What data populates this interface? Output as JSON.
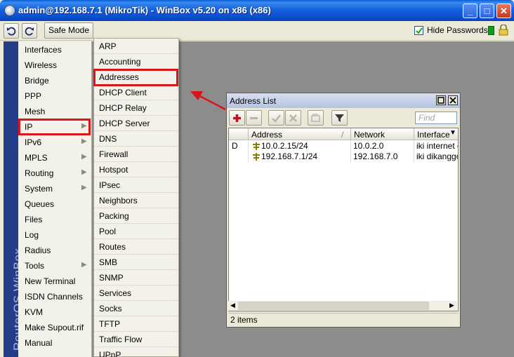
{
  "window": {
    "title": "admin@192.168.7.1 (MikroTik) - WinBox v5.20 on x86 (x86)",
    "minimize": "_",
    "maximize": "□",
    "close": "✕"
  },
  "toolbar": {
    "safe_mode": "Safe Mode",
    "hide_passwords_label": "Hide Passwords",
    "hide_passwords_checked": true
  },
  "brand": "RouterOS WinBox",
  "main_menu": [
    {
      "label": "Interfaces",
      "arrow": false
    },
    {
      "label": "Wireless",
      "arrow": false
    },
    {
      "label": "Bridge",
      "arrow": false
    },
    {
      "label": "PPP",
      "arrow": false
    },
    {
      "label": "Mesh",
      "arrow": false
    },
    {
      "label": "IP",
      "arrow": true
    },
    {
      "label": "IPv6",
      "arrow": true
    },
    {
      "label": "MPLS",
      "arrow": true
    },
    {
      "label": "Routing",
      "arrow": true
    },
    {
      "label": "System",
      "arrow": true
    },
    {
      "label": "Queues",
      "arrow": false
    },
    {
      "label": "Files",
      "arrow": false
    },
    {
      "label": "Log",
      "arrow": false
    },
    {
      "label": "Radius",
      "arrow": false
    },
    {
      "label": "Tools",
      "arrow": true
    },
    {
      "label": "New Terminal",
      "arrow": false
    },
    {
      "label": "ISDN Channels",
      "arrow": false
    },
    {
      "label": "KVM",
      "arrow": false
    },
    {
      "label": "Make Supout.rif",
      "arrow": false
    },
    {
      "label": "Manual",
      "arrow": false
    }
  ],
  "ip_submenu": [
    "ARP",
    "Accounting",
    "Addresses",
    "DHCP Client",
    "DHCP Relay",
    "DHCP Server",
    "DNS",
    "Firewall",
    "Hotspot",
    "IPsec",
    "Neighbors",
    "Packing",
    "Pool",
    "Routes",
    "SMB",
    "SNMP",
    "Services",
    "Socks",
    "TFTP",
    "Traffic Flow",
    "UPnP"
  ],
  "address_list": {
    "title": "Address List",
    "find_placeholder": "Find",
    "columns": [
      "",
      "Address",
      "Network",
      "Interface"
    ],
    "rows": [
      {
        "flag": "D",
        "address": "10.0.2.15/24",
        "network": "10.0.2.0",
        "interface": "iki internet e"
      },
      {
        "flag": "",
        "address": "192.168.7.1/24",
        "network": "192.168.7.0",
        "interface": "iki dikanggo"
      }
    ],
    "status": "2 items"
  },
  "colors": {
    "highlight": "#d9141a",
    "titlebar": "#0b4fcf",
    "brand_bar": "#253c8a"
  }
}
